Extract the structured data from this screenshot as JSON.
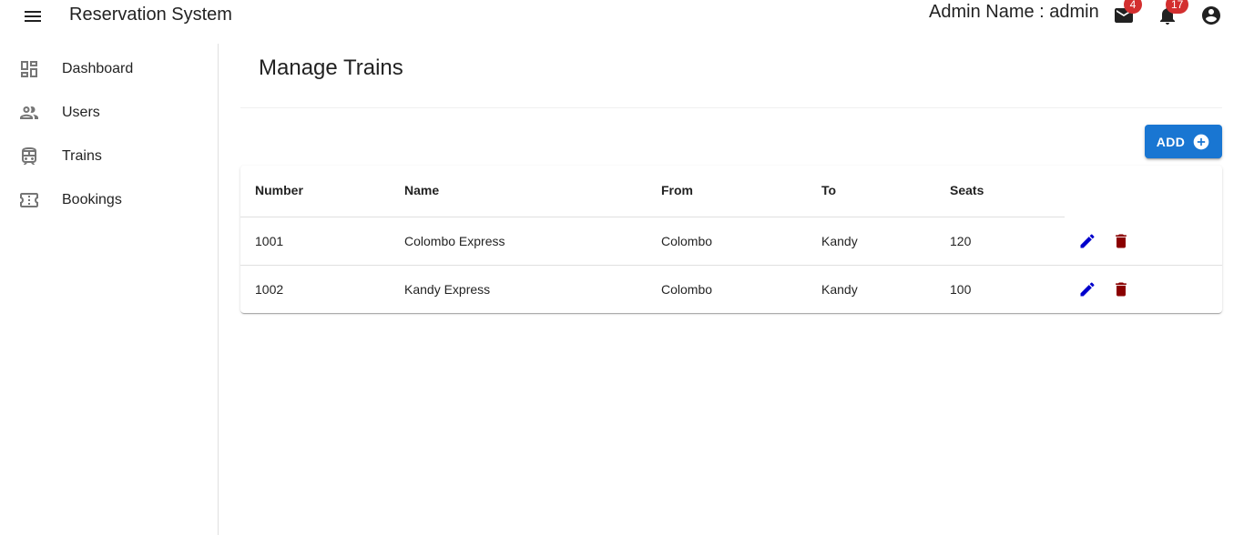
{
  "app": {
    "title": "Reservation System",
    "admin_label": "Admin Name : admin"
  },
  "header": {
    "mail_badge": "4",
    "notifications_badge": "17",
    "icons": [
      "menu-icon",
      "mail-icon",
      "bell-icon",
      "account-icon"
    ]
  },
  "sidebar": {
    "items": [
      {
        "label": "Dashboard",
        "icon": "dashboard-icon"
      },
      {
        "label": "Users",
        "icon": "users-icon"
      },
      {
        "label": "Trains",
        "icon": "train-icon"
      },
      {
        "label": "Bookings",
        "icon": "ticket-icon"
      }
    ]
  },
  "main": {
    "title": "Manage Trains",
    "add_label": "ADD",
    "table": {
      "headers": [
        "Number",
        "Name",
        "From",
        "To",
        "Seats"
      ],
      "rows": [
        [
          "1001",
          "Colombo Express",
          "Colombo",
          "Kandy",
          "120"
        ],
        [
          "1002",
          "Kandy Express",
          "Colombo",
          "Kandy",
          "100"
        ]
      ]
    }
  },
  "colors": {
    "primary": "#1976d2",
    "badge": "#d32f2f",
    "edit": "#0000cc",
    "delete": "#8b0000"
  }
}
